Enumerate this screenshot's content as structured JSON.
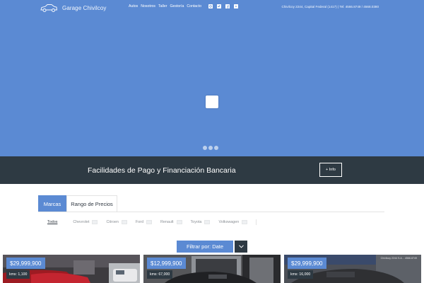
{
  "header": {
    "brand_name": "Garage Chivilcoy",
    "nav": [
      "Autos",
      "Nosotros",
      "Taller",
      "Gestoría",
      "Contacto"
    ],
    "social_icons": [
      "instagram-icon",
      "twitter-icon",
      "facebook-icon",
      "youtube-icon"
    ],
    "contact": "Chivilcoy 2244, Capital Federal (1417)  |  Tel: 4566.8749 / 4568.0380"
  },
  "hero": {
    "slide_count": 3,
    "active_slide": 1
  },
  "banner": {
    "text": "Facilidades de Pago y Financiación Bancaria",
    "button": "+ Info"
  },
  "tabs": [
    {
      "label": "Marcas",
      "active": true
    },
    {
      "label": "Rango de Precios",
      "active": false
    }
  ],
  "brands": [
    "Todos",
    "Chevrolet",
    "Citroen",
    "Ford",
    "Renault",
    "Toyota",
    "Volkswagen"
  ],
  "filter": {
    "label": "Filtrar por: Date"
  },
  "cars": [
    {
      "price": "$29,999,900",
      "kms": "kms: 1,100"
    },
    {
      "price": "$12,999,900",
      "kms": "kms: 67,000"
    },
    {
      "price": "$29,999,900",
      "kms": "kms: 16,000",
      "sign": "Chivilcoy 2244 S.A. - 4566.8749"
    }
  ],
  "colors": {
    "accent": "#5b8ad3",
    "dark": "#2e3a43",
    "white": "#ffffff"
  }
}
